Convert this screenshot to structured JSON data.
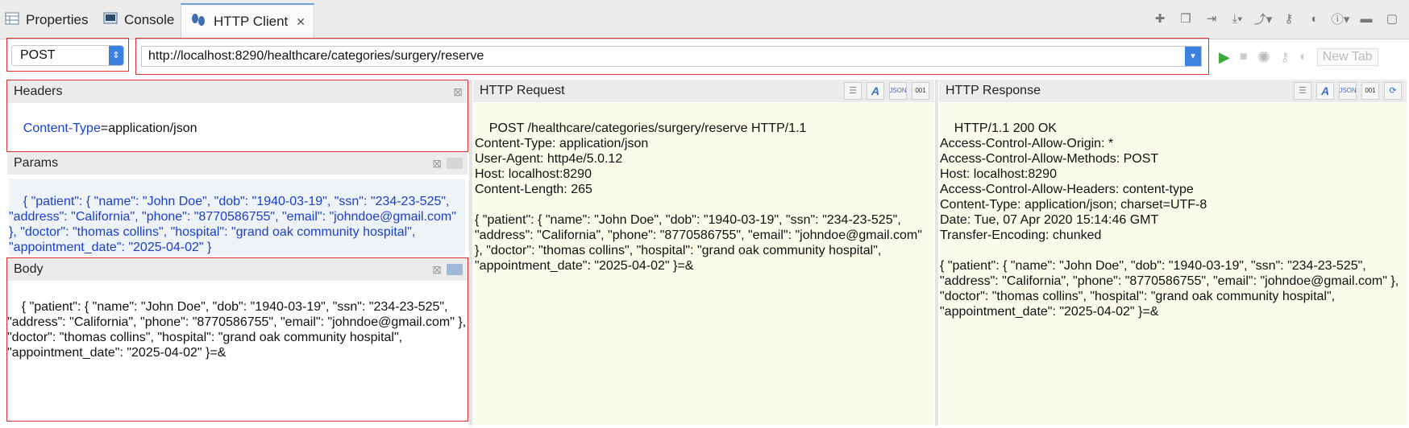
{
  "tabs": [
    {
      "label": "Properties",
      "icon": "properties-icon"
    },
    {
      "label": "Console",
      "icon": "console-icon"
    },
    {
      "label": "HTTP Client",
      "icon": "http-client-icon"
    }
  ],
  "request": {
    "method": "POST",
    "url": "http://localhost:8290/healthcare/categories/surgery/reserve"
  },
  "toolbar": {
    "new_tab_label": "New Tab"
  },
  "headers_panel": {
    "title": "Headers",
    "key": "Content-Type",
    "value": "=application/json"
  },
  "params_panel": {
    "title": "Params",
    "content": "{ \"patient\": { \"name\": \"John Doe\", \"dob\": \"1940-03-19\", \"ssn\": \"234-23-525\", \"address\": \"California\", \"phone\": \"8770586755\", \"email\": \"johndoe@gmail.com\" }, \"doctor\": \"thomas collins\", \"hospital\": \"grand oak community hospital\", \"appointment_date\": \"2025-04-02\" }"
  },
  "body_panel": {
    "title": "Body",
    "content": "{ \"patient\": { \"name\": \"John Doe\", \"dob\": \"1940-03-19\", \"ssn\": \"234-23-525\", \"address\": \"California\", \"phone\": \"8770586755\", \"email\": \"johndoe@gmail.com\" }, \"doctor\": \"thomas collins\", \"hospital\": \"grand oak community hospital\", \"appointment_date\": \"2025-04-02\" }=&"
  },
  "http_request": {
    "title": "HTTP Request",
    "content": "POST /healthcare/categories/surgery/reserve HTTP/1.1\nContent-Type: application/json\nUser-Agent: http4e/5.0.12\nHost: localhost:8290\nContent-Length: 265\n\n{ \"patient\": { \"name\": \"John Doe\", \"dob\": \"1940-03-19\", \"ssn\": \"234-23-525\", \"address\": \"California\", \"phone\": \"8770586755\", \"email\": \"johndoe@gmail.com\" }, \"doctor\": \"thomas collins\", \"hospital\": \"grand oak community hospital\", \"appointment_date\": \"2025-04-02\" }=&"
  },
  "http_response": {
    "title": "HTTP Response",
    "content": "HTTP/1.1 200 OK\nAccess-Control-Allow-Origin: *\nAccess-Control-Allow-Methods: POST\nHost: localhost:8290\nAccess-Control-Allow-Headers: content-type\nContent-Type: application/json; charset=UTF-8\nDate: Tue, 07 Apr 2020 15:14:46 GMT\nTransfer-Encoding: chunked\n\n{ \"patient\": { \"name\": \"John Doe\", \"dob\": \"1940-03-19\", \"ssn\": \"234-23-525\", \"address\": \"California\", \"phone\": \"8770586755\", \"email\": \"johndoe@gmail.com\" }, \"doctor\": \"thomas collins\", \"hospital\": \"grand oak community hospital\", \"appointment_date\": \"2025-04-02\" }=&"
  },
  "colors": {
    "highlight_outline": "#e03030",
    "accent": "#3b82e0",
    "key_text": "#1a3fd1",
    "panel_bg": "#fbfbe9"
  }
}
